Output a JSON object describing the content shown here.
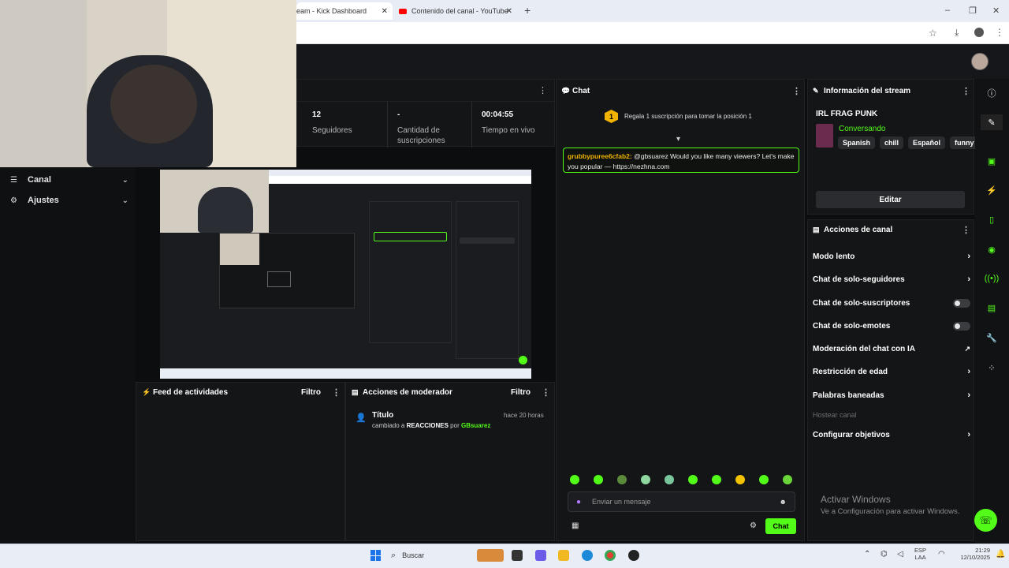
{
  "browser": {
    "tabs": [
      {
        "label": "eam - Kick Dashboard"
      },
      {
        "label": "Contenido del canal - YouTube"
      }
    ],
    "new_tab": "+",
    "window_controls": [
      "–",
      "❐",
      "✕"
    ]
  },
  "stats": {
    "followers": {
      "value": "12",
      "label": "Seguidores"
    },
    "subs": {
      "value": "-",
      "label": "Cantidad de suscripciones"
    },
    "live": {
      "value": "00:04:55",
      "label": "Tiempo en vivo"
    }
  },
  "left_nav": {
    "items": [
      {
        "label": "Canal",
        "icon": "layers-icon"
      },
      {
        "label": "Ajustes",
        "icon": "gear-icon"
      }
    ]
  },
  "activity": {
    "title": "Feed de actividades",
    "filter": "Filtro"
  },
  "mod_actions": {
    "title": "Acciones de moderador",
    "filter": "Filtro",
    "entry": {
      "title": "Título",
      "time": "hace 20 horas",
      "desc_prefix": "cambiado a",
      "desc_value": "REACCIONES",
      "desc_by": "por",
      "desc_user": "GBsuarez"
    }
  },
  "chat": {
    "title": "Chat",
    "pinned": {
      "rank": "1",
      "text": "Regala 1 suscripción para tomar la posición 1"
    },
    "message": {
      "user": "grubbypuree6cfab2:",
      "text": "@gbsuarez Would you like many viewers? Let's make you popular — https://nezhna.com"
    },
    "input_placeholder": "Enviar un mensaje",
    "send_label": "Chat"
  },
  "stream_info": {
    "title": "Información del stream",
    "stream_title": "IRL FRAG PUNK",
    "category": "Conversando",
    "tags": [
      "Spanish",
      "chill",
      "Español",
      "funny"
    ],
    "edit_label": "Editar"
  },
  "channel_actions": {
    "title": "Acciones de canal",
    "items": [
      {
        "label": "Modo lento",
        "control": "chevron"
      },
      {
        "label": "Chat de solo-seguidores",
        "control": "chevron"
      },
      {
        "label": "Chat de solo-suscriptores",
        "control": "toggle"
      },
      {
        "label": "Chat de solo-emotes",
        "control": "toggle"
      },
      {
        "label": "Moderación del chat con IA",
        "control": "external"
      },
      {
        "label": "Restricción de edad",
        "control": "chevron"
      },
      {
        "label": "Palabras baneadas",
        "control": "chevron"
      },
      {
        "label": "Hostear canal",
        "control": "none",
        "disabled": true
      },
      {
        "label": "Configurar objetivos",
        "control": "chevron"
      }
    ]
  },
  "watermark": {
    "line1": "Activar Windows",
    "line2": "Ve a Configuración para activar Windows."
  },
  "taskbar": {
    "search": "Buscar",
    "lang": "ESP",
    "lang2": "LAA",
    "time": "21:29",
    "date": "12/10/2025"
  },
  "colors": {
    "accent": "#53fc18",
    "panel": "#141517",
    "bg": "#0c0d0e"
  }
}
